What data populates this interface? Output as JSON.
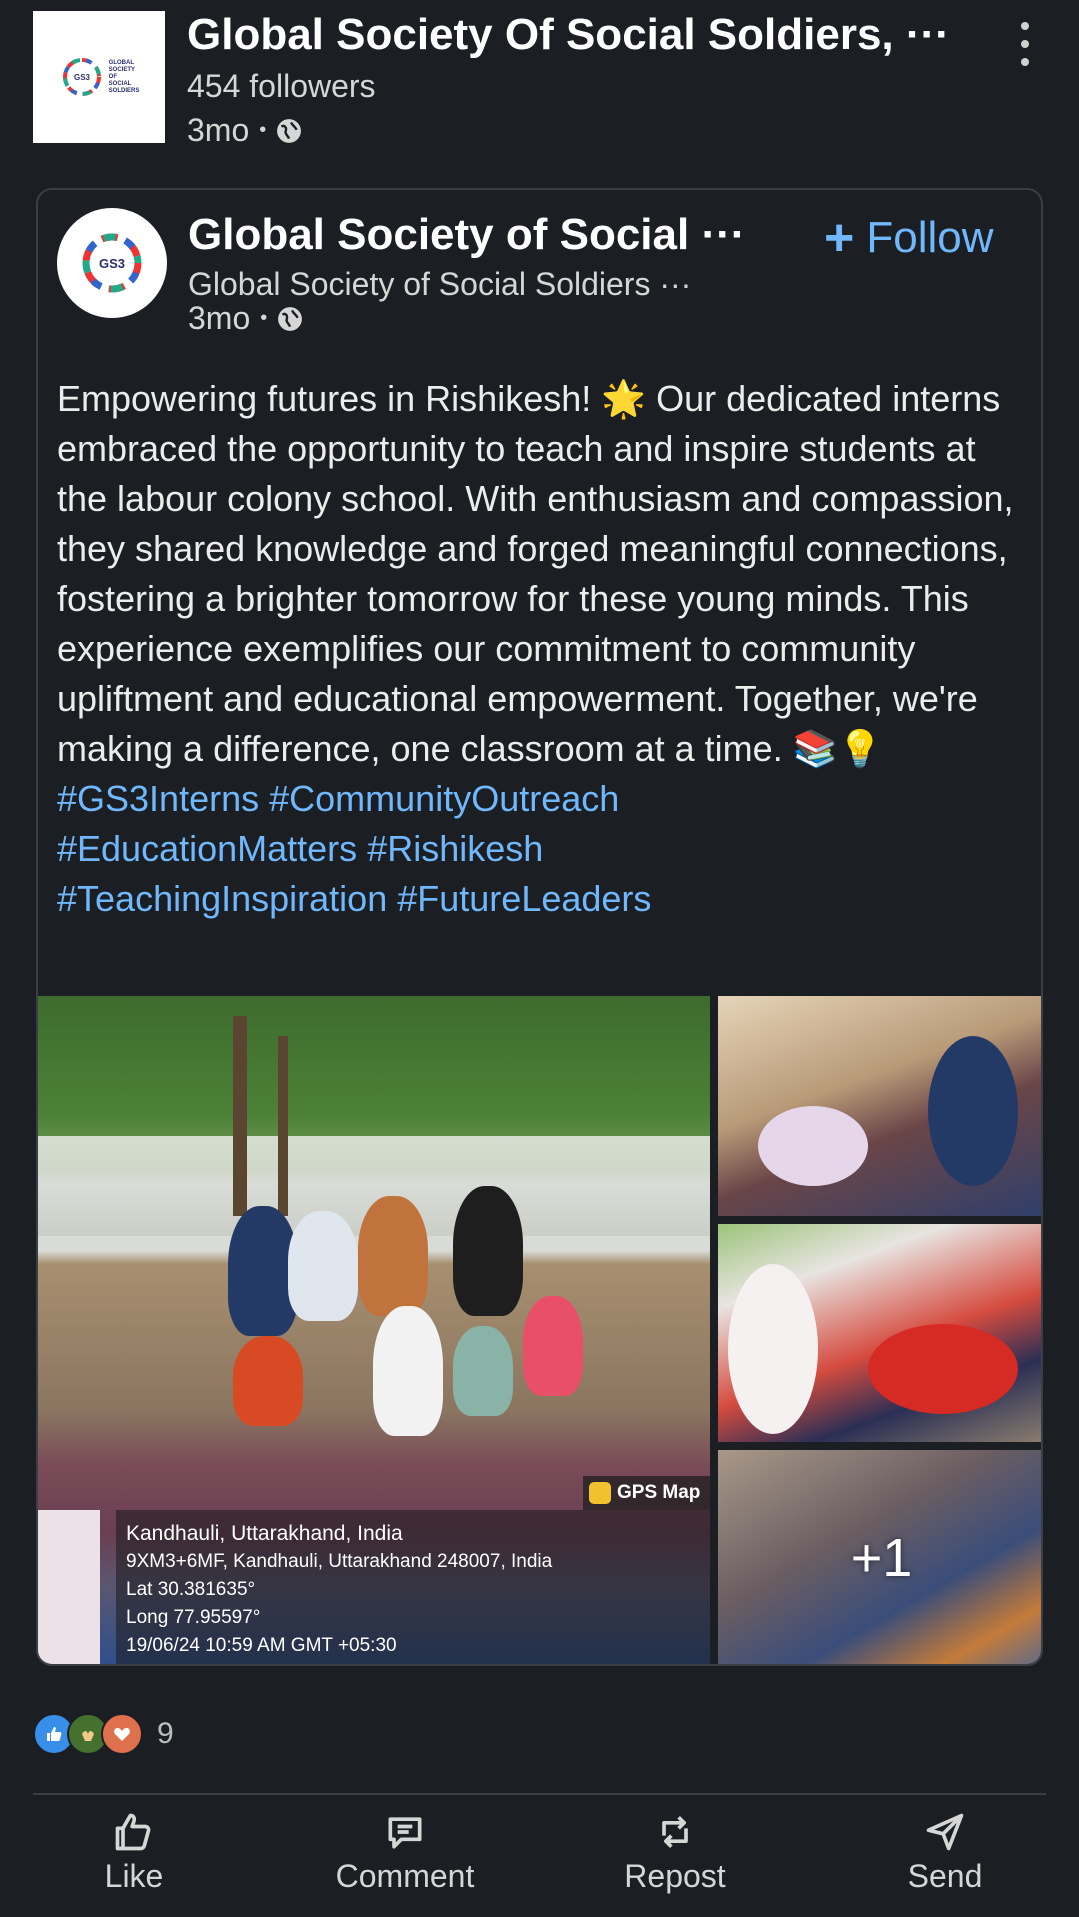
{
  "reshare": {
    "org_name": "Global Society Of Social Soldiers, ···",
    "followers": "454 followers",
    "time": "3mo",
    "separator": "•",
    "logo_text": [
      "GLOBAL",
      "SOCIETY",
      "OF",
      "SOCIAL",
      "SOLDIERS"
    ],
    "logo_badge": "GS3"
  },
  "post": {
    "author": "Global Society of Social ···",
    "author_sub": "Global Society of Social Soldiers ···",
    "time": "3mo",
    "separator": "•",
    "follow_plus": "+",
    "follow_label": "Follow",
    "body": "Empowering futures in Rishikesh! 🌟 Our dedicated interns embraced the opportunity to teach and inspire students at the labour colony school. With enthusiasm and compassion, they shared knowledge and forged meaningful connections, fostering a brighter tomorrow for these young minds. This experience exemplifies our commitment to community upliftment and educational empowerment. Together, we're making a difference, one classroom at a time. 📚💡",
    "hashtags": [
      "#GS3Interns",
      "#CommunityOutreach",
      "#EducationMatters",
      "#Rishikesh",
      "#TeachingInspiration",
      "#FutureLeaders"
    ]
  },
  "photo": {
    "gps_label": "GPS Map",
    "location": "Kandhauli, Uttarakhand, India",
    "address": "9XM3+6MF, Kandhauli, Uttarakhand 248007, India",
    "lat": "Lat 30.381635°",
    "long": "Long 77.95597°",
    "timestamp": "19/06/24 10:59 AM GMT +05:30",
    "more_count": "+1"
  },
  "reactions": {
    "count": "9",
    "icons": [
      "like-reaction-icon",
      "celebrate-reaction-icon",
      "love-reaction-icon"
    ],
    "colors": {
      "like": "#378fe9",
      "celebrate": "#44712e",
      "love": "#df704d"
    }
  },
  "actions": {
    "like": "Like",
    "comment": "Comment",
    "repost": "Repost",
    "send": "Send"
  },
  "colors": {
    "background": "#1b1f23",
    "link": "#71b7fb",
    "text": "#e9e9e9"
  }
}
